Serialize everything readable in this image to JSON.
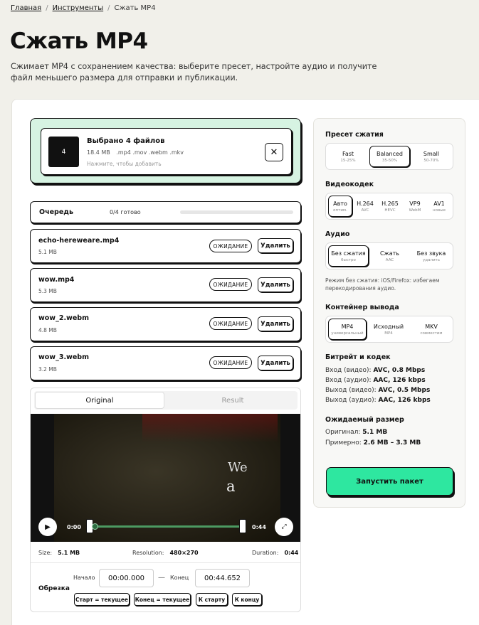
{
  "breadcrumb": {
    "home": "Главная",
    "tools": "Инструменты",
    "current": "Сжать MP4",
    "sep": "/"
  },
  "page": {
    "title": "Сжать MP4",
    "lead": "Сжимает MP4 с сохранением качества: выберите пресет, настройте аудио и получите файл меньшего размера для отправки и публикации."
  },
  "upload": {
    "count_badge": "4",
    "title": "Выбрано 4 файлов",
    "total_size": "18.4 MB",
    "formats": ".mp4 .mov .webm .mkv",
    "hint": "Нажмите, чтобы добавить",
    "clear_icon": "close-icon",
    "clear_glyph": "✕"
  },
  "queue": {
    "label": "Очередь",
    "progress": "0/4 готово",
    "progress_fraction": 0
  },
  "files": [
    {
      "name": "echo-hereweare.mp4",
      "size": "5.1 MB",
      "status": "ОЖИДАНИЕ",
      "remove": "Удалить"
    },
    {
      "name": "wow.mp4",
      "size": "5.3 MB",
      "status": "ОЖИДАНИЕ",
      "remove": "Удалить"
    },
    {
      "name": "wow_2.webm",
      "size": "4.8 MB",
      "status": "ОЖИДАНИЕ",
      "remove": "Удалить"
    },
    {
      "name": "wow_3.webm",
      "size": "3.2 MB",
      "status": "ОЖИДАНИЕ",
      "remove": "Удалить"
    }
  ],
  "player": {
    "tab_original": "Original",
    "tab_result": "Result",
    "frame_text_1": "We",
    "frame_text_2": "a",
    "play_glyph": "▶",
    "fullscreen_glyph": "⤢",
    "time_start": "0:00",
    "time_end": "0:44",
    "size_label": "Size:",
    "size_value": "5.1 MB",
    "resolution_label": "Resolution:",
    "resolution_value": "480×270",
    "duration_label": "Duration:",
    "duration_value": "0:44"
  },
  "trim": {
    "label": "Обрезка",
    "start_label": "Начало",
    "start_value": "00:00.000",
    "dash": "—",
    "end_label": "Конец",
    "end_value": "00:44.652",
    "btn_start_current": "Старт = текущее",
    "btn_end_current": "Конец = текущее",
    "btn_to_start": "К старту",
    "btn_to_end": "К концу"
  },
  "settings": {
    "preset": {
      "label": "Пресет сжатия",
      "options": [
        {
          "main": "Fast",
          "sub": "15-25%"
        },
        {
          "main": "Balanced",
          "sub": "35-50%"
        },
        {
          "main": "Small",
          "sub": "50-70%"
        }
      ],
      "selected": 1
    },
    "codec": {
      "label": "Видеокодек",
      "options": [
        {
          "main": "Авто",
          "sub": "оптим."
        },
        {
          "main": "H.264",
          "sub": "AVC"
        },
        {
          "main": "H.265",
          "sub": "HEVC"
        },
        {
          "main": "VP9",
          "sub": "WebM"
        },
        {
          "main": "AV1",
          "sub": "новые"
        }
      ],
      "selected": 0
    },
    "audio": {
      "label": "Аудио",
      "options": [
        {
          "main": "Без сжатия",
          "sub": "быстро"
        },
        {
          "main": "Сжать",
          "sub": "AAC"
        },
        {
          "main": "Без звука",
          "sub": "удалить"
        }
      ],
      "selected": 0,
      "note": "Режим без сжатия: iOS/Firefox: избегаем перекодирования аудио."
    },
    "container": {
      "label": "Контейнер вывода",
      "options": [
        {
          "main": "MP4",
          "sub": "универсальный"
        },
        {
          "main": "Исходный",
          "sub": "MP4"
        },
        {
          "main": "MKV",
          "sub": "совместим"
        }
      ],
      "selected": 0
    },
    "bitrate": {
      "label": "Битрейт и кодек",
      "rows": [
        {
          "k": "Вход (видео):",
          "v": "AVC, 0.8 Mbps"
        },
        {
          "k": "Вход (аудио):",
          "v": "AAC, 126 kbps"
        },
        {
          "k": "Выход (видео):",
          "v": "AVC, 0.5 Mbps"
        },
        {
          "k": "Выход (аудио):",
          "v": "AAC, 126 kbps"
        }
      ]
    },
    "estimate": {
      "label": "Ожидаемый размер",
      "rows": [
        {
          "k": "Оригинал:",
          "v": "5.1 MB"
        },
        {
          "k": "Примерно:",
          "v": "2.6 MB – 3.3 MB"
        }
      ]
    },
    "run_button": "Запустить пакет"
  },
  "colors": {
    "accent": "#2ee7a0",
    "drop_bg": "#d6f3e2",
    "track": "#4c9a62"
  }
}
